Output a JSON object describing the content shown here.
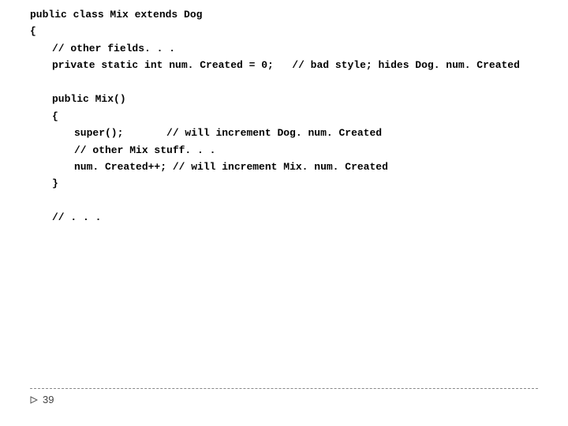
{
  "code": {
    "l1": "public class Mix extends Dog",
    "l2": "{",
    "l3": "// other fields. . .",
    "l4a": "private static int num. Created = 0;",
    "l4b": "// bad style; hides Dog. num. Created",
    "l5": "public Mix()",
    "l6": "{",
    "l7a": "super();",
    "l7b": "// will increment Dog. num. Created",
    "l8": "// other Mix stuff. . .",
    "l9a": "num. Created++;",
    "l9b": "// will increment Mix. num. Created",
    "l10": "}",
    "l11": "// . . ."
  },
  "footer": {
    "page_number": "39"
  }
}
